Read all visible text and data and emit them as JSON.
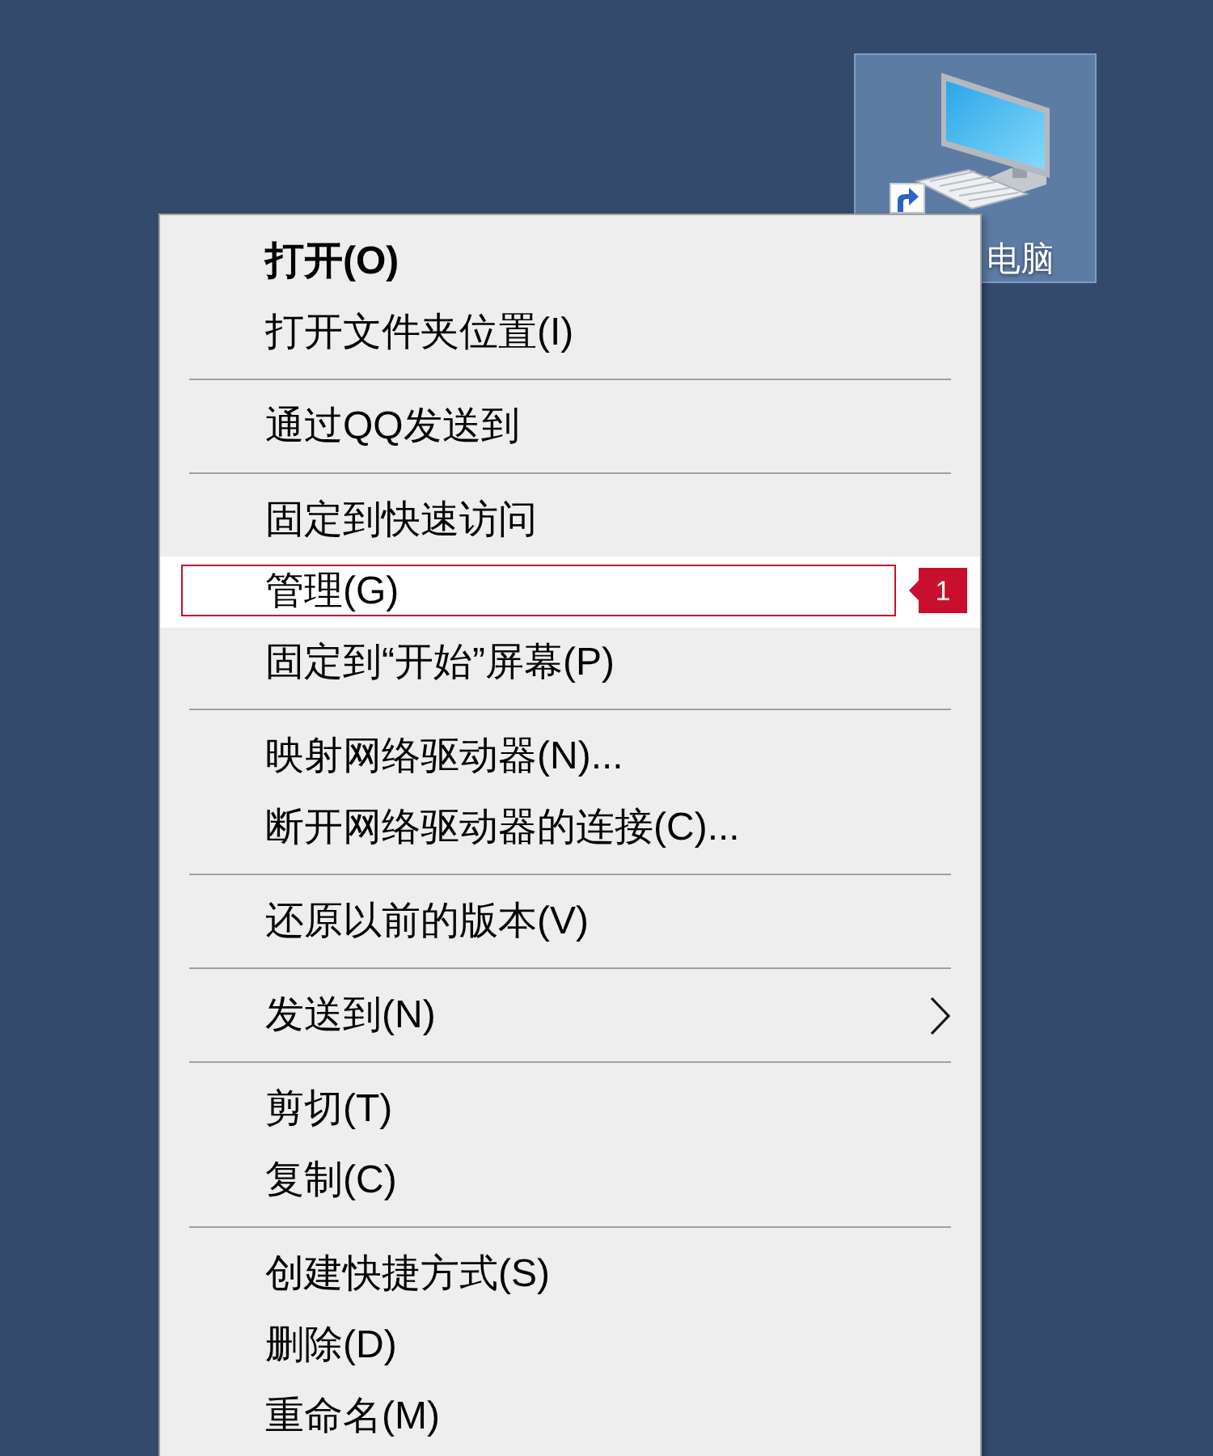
{
  "desktop": {
    "icons": [
      {
        "label": "电脑",
        "selected": true,
        "shortcut": true
      }
    ]
  },
  "context_menu": {
    "groups": [
      {
        "items": [
          {
            "label": "打开(O)",
            "default": true,
            "selected": false,
            "submenu": false
          },
          {
            "label": "打开文件夹位置(I)",
            "default": false,
            "selected": false,
            "submenu": false
          }
        ]
      },
      {
        "items": [
          {
            "label": "通过QQ发送到",
            "default": false,
            "selected": false,
            "submenu": false
          }
        ]
      },
      {
        "items": [
          {
            "label": "固定到快速访问",
            "default": false,
            "selected": false,
            "submenu": false
          },
          {
            "label": "管理(G)",
            "default": false,
            "selected": true,
            "submenu": false,
            "callout": "1"
          },
          {
            "label": "固定到“开始”屏幕(P)",
            "default": false,
            "selected": false,
            "submenu": false
          }
        ]
      },
      {
        "items": [
          {
            "label": "映射网络驱动器(N)...",
            "default": false,
            "selected": false,
            "submenu": false
          },
          {
            "label": "断开网络驱动器的连接(C)...",
            "default": false,
            "selected": false,
            "submenu": false
          }
        ]
      },
      {
        "items": [
          {
            "label": "还原以前的版本(V)",
            "default": false,
            "selected": false,
            "submenu": false
          }
        ]
      },
      {
        "items": [
          {
            "label": "发送到(N)",
            "default": false,
            "selected": false,
            "submenu": true
          }
        ]
      },
      {
        "items": [
          {
            "label": "剪切(T)",
            "default": false,
            "selected": false,
            "submenu": false
          },
          {
            "label": "复制(C)",
            "default": false,
            "selected": false,
            "submenu": false
          }
        ]
      },
      {
        "items": [
          {
            "label": "创建快捷方式(S)",
            "default": false,
            "selected": false,
            "submenu": false
          },
          {
            "label": "删除(D)",
            "default": false,
            "selected": false,
            "submenu": false
          },
          {
            "label": "重命名(M)",
            "default": false,
            "selected": false,
            "submenu": false
          }
        ]
      }
    ]
  }
}
